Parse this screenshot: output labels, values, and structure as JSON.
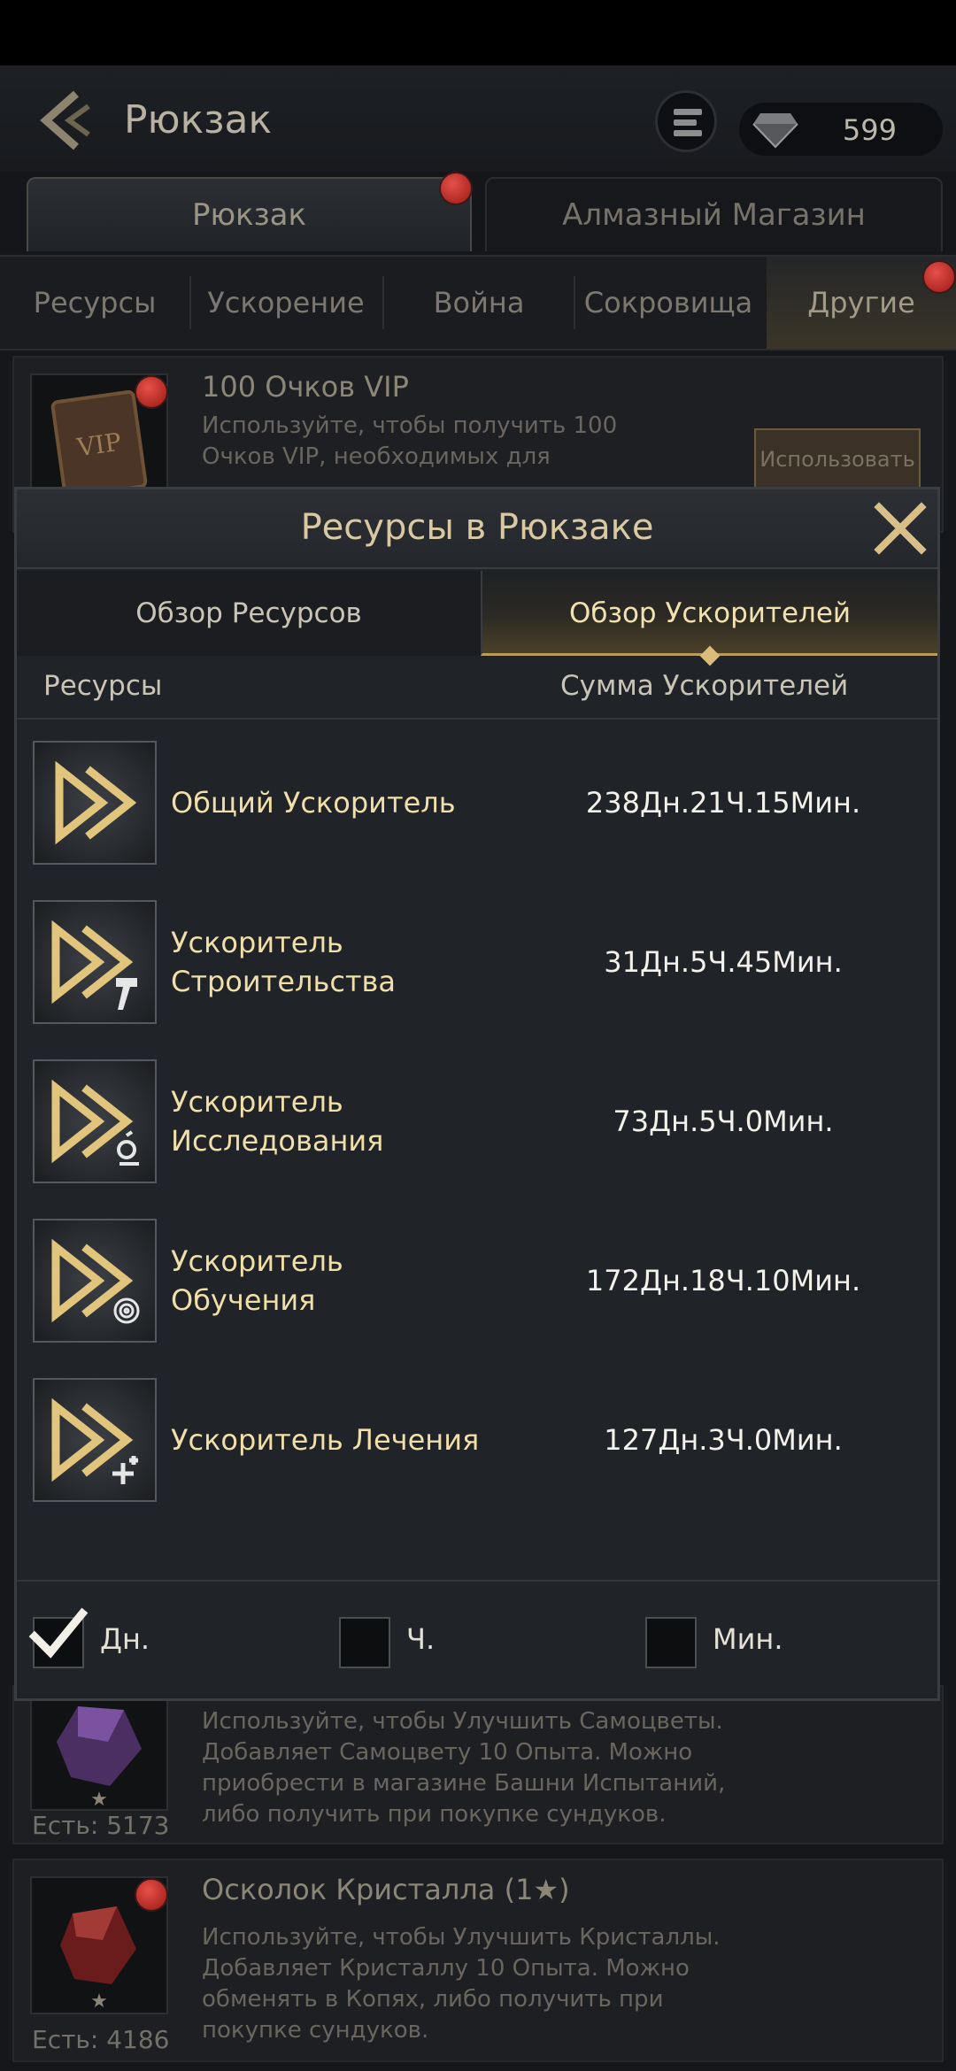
{
  "header": {
    "title": "Рюкзак",
    "diamonds": "599"
  },
  "main_tabs": {
    "backpack": "Рюкзак",
    "shop": "Алмазный Магазин"
  },
  "sub_tabs": [
    "Ресурсы",
    "Ускорение",
    "Война",
    "Сокровища",
    "Другие"
  ],
  "items": {
    "vip": {
      "name": "100 Очков VIP",
      "desc": "Используйте, чтобы получить 100 Очков VIP, необходимых для",
      "button": "Использовать"
    },
    "gem": {
      "desc": "Используйте, чтобы Улучшить Самоцветы. Добавляет Самоцвету 10 Опыта. Можно приобрести в магазине Башни Испытаний, либо получить при покупке сундуков.",
      "count": "Есть: 5173"
    },
    "crystal": {
      "name": "Осколок Кристалла (1★)",
      "desc": "Используйте, чтобы Улучшить Кристаллы. Добавляет Кристаллу 10 Опыта. Можно обменять в Копях, либо получить при покупке сундуков.",
      "count": "Есть: 4186"
    }
  },
  "modal": {
    "title": "Ресурсы в Рюкзаке",
    "tabs": {
      "overview": "Обзор Ресурсов",
      "speedups": "Обзор Ускорителей"
    },
    "columns": {
      "resources": "Ресурсы",
      "sum": "Сумма Ускорителей"
    },
    "rows": [
      {
        "name": "Общий Ускоритель",
        "value": "238Дн.21Ч.15Мин."
      },
      {
        "name": "Ускоритель Строительства",
        "value": "31Дн.5Ч.45Мин."
      },
      {
        "name": "Ускоритель Исследования",
        "value": "73Дн.5Ч.0Мин."
      },
      {
        "name": "Ускоритель Обучения",
        "value": "172Дн.18Ч.10Мин."
      },
      {
        "name": "Ускоритель Лечения",
        "value": "127Дн.3Ч.0Мин."
      }
    ],
    "units": {
      "days": "Дн.",
      "hours": "Ч.",
      "minutes": "Мин."
    },
    "units_checked": {
      "days": true,
      "hours": false,
      "minutes": false
    }
  },
  "colors": {
    "accent_gold": "#d9bd7a",
    "row_text": "#f1dfaa",
    "badge_red": "#c8302a"
  }
}
